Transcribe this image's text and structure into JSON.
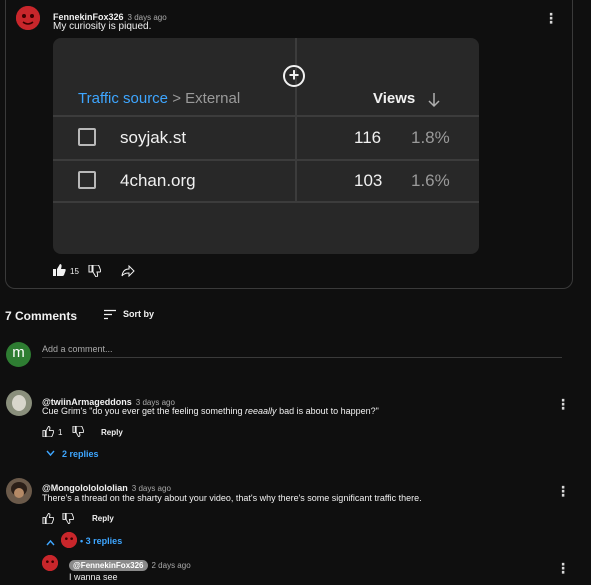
{
  "post": {
    "author": "FennekinFox326",
    "time": "3 days ago",
    "text": "My curiosity is piqued.",
    "likes": "15",
    "analytics": {
      "source_label": "Traffic source",
      "separator": ">",
      "source_value": "External",
      "views_label": "Views",
      "rows": [
        {
          "name": "soyjak.st",
          "views": "116",
          "pct": "1.8%"
        },
        {
          "name": "4chan.org",
          "views": "103",
          "pct": "1.6%"
        }
      ]
    }
  },
  "comments": {
    "count_label": "7 Comments",
    "sort_label": "Sort by",
    "add_placeholder": "Add a comment...",
    "user_initial": "m",
    "items": [
      {
        "author": "@twiinArmageddons",
        "time": "3 days ago",
        "text_before": "Cue Grim's \"do you ever get the feeling something ",
        "text_em": "reeaally",
        "text_after": " bad is about to happen?\"",
        "likes": "1",
        "reply_label": "Reply",
        "replies_label": "2 replies"
      },
      {
        "author": "@Mongolololololian",
        "time": "3 days ago",
        "text": "There's a thread on the sharty about your video, that's why there's some significant traffic there.",
        "reply_label": "Reply",
        "replies_label": "3 replies",
        "replies_sep": "•"
      }
    ],
    "reply": {
      "mention": "@FennekinFox326",
      "time": "2 days ago",
      "text": "I wanna see"
    }
  },
  "colors": {
    "background": "#0f0f0f",
    "link_blue": "#3ea6ff",
    "avatar_red": "#c8262b",
    "user_avatar_green": "#2e7d32"
  },
  "icons": [
    "thumbs-up-filled-icon",
    "thumbs-down-icon",
    "share-icon",
    "sort-icon",
    "kebab-menu-icon",
    "plus-circle-icon",
    "chevron-down-icon",
    "chevron-up-icon",
    "arrow-down-icon",
    "chevron-right-icon"
  ]
}
